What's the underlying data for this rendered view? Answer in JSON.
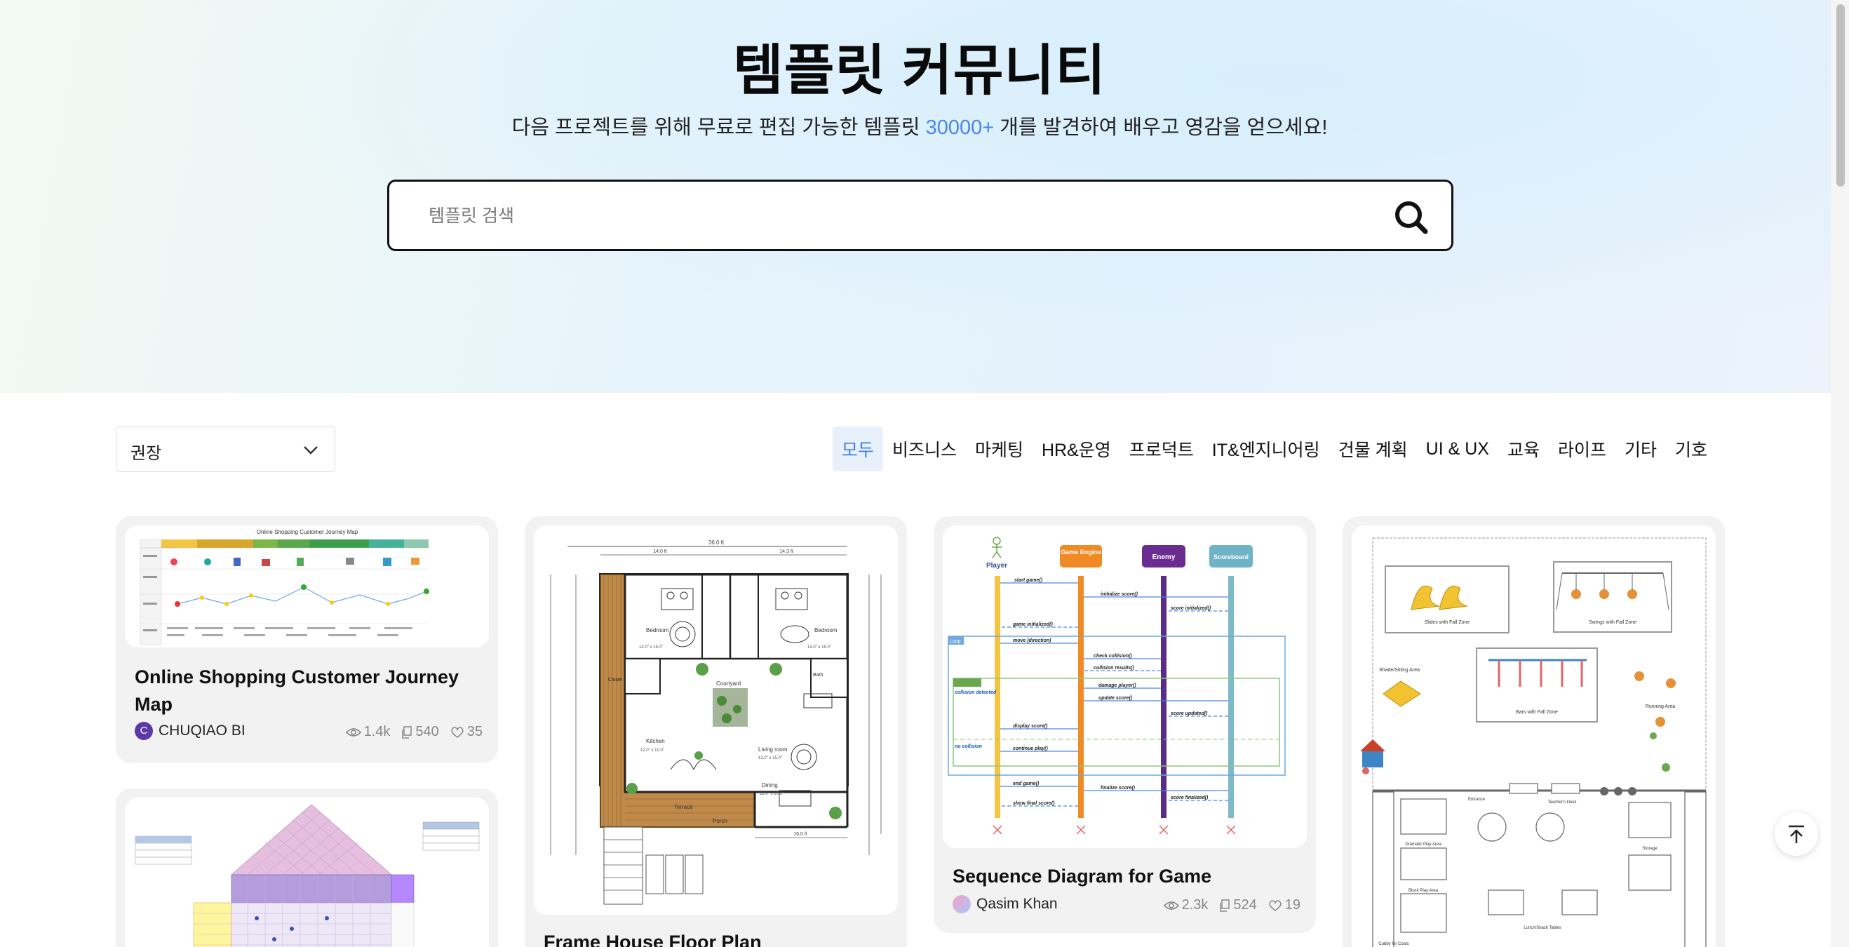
{
  "hero": {
    "title": "템플릿 커뮤니티",
    "subtitle_before": "다음 프로젝트를 위해 무료로 편집 가능한 템플릿 ",
    "subtitle_count": "30000+",
    "subtitle_after": " 개를 발견하여 배우고 영감을 얻으세요!"
  },
  "search": {
    "placeholder": "템플릿 검색",
    "icon": "search-icon"
  },
  "sort": {
    "selected": "권장",
    "icon": "chevron-down-icon"
  },
  "categories": [
    "모두",
    "비즈니스",
    "마케팅",
    "HR&운영",
    "프로덕트",
    "IT&엔지니어링",
    "건물 계획",
    "UI & UX",
    "교육",
    "라이프",
    "기타",
    "기호"
  ],
  "cards": [
    {
      "title": "Online Shopping Customer Journey Map",
      "author": "CHUQIAO BI",
      "avatar_letter": "C",
      "avatar_color": "#5b3aa8",
      "views": "1.4k",
      "copies": "540",
      "likes": "35"
    },
    {
      "title": "Frame House Floor Plan"
    },
    {
      "title": "Sequence Diagram for Game",
      "author": "Qasim Khan",
      "views": "2.3k",
      "copies": "524",
      "likes": "19"
    },
    {
      "title": ""
    }
  ],
  "thumb_text": {
    "journey_title": "Online Shopping Customer Journey Map",
    "floor": {
      "dim_top": "36.0 ft",
      "dim_a": "14.0 ft",
      "dim_b": "14.3 ft",
      "bed1": "Bedroom",
      "bed1_size": "14.0\" x 15.0\"",
      "bed2": "Bedroom",
      "bed2_size": "14.0\" x 15.0\"",
      "bath": "Bath",
      "closet": "Closet",
      "courtyard": "Courtyard",
      "kitchen": "Kitchen",
      "kitchen_size": "12.0\" x 10.0\"",
      "living": "Living room",
      "living_size": "12.0\" x 15.0\"",
      "dining": "Dining",
      "dining_size": "12.0\" x 10.0\"",
      "terrace": "Terrace",
      "porch": "Porch",
      "dim_bottom": "16.0 ft"
    },
    "seq": {
      "player": "Player",
      "engine": "Game Engine",
      "enemy": "Enemy",
      "scoreboard": "Scoreboard",
      "m1": "start game()",
      "m2": "initialize score()",
      "m3": "score initialized()",
      "m4": "game initialized()",
      "m5": "move (direction)",
      "m6": "check collision()",
      "m7": "collision results()",
      "m8": "damage player()",
      "m9": "update score()",
      "m10": "score updated()",
      "m11": "display score()",
      "m12": "continue play()",
      "m13": "end game()",
      "m14": "finalize score()",
      "m15": "score finalized()",
      "m16": "show final score()",
      "loop": "Loop",
      "alt1": "collision detected",
      "alt2": "no collision"
    },
    "play": {
      "a1": "Slides with Fall Zone",
      "a2": "Swings with Fall Zone",
      "a3": "Shade/Sitting Area",
      "a4": "Bars with Fall Zone",
      "a5": "Running Area",
      "a6": "Entrance",
      "a7": "Teacher's Desk",
      "a8": "Storage",
      "a9": "Dramatic Play Area",
      "a10": "Block Play Area",
      "a11": "Lunch/Snack Tables",
      "a12": "Cubby for Coats"
    }
  },
  "colors": {
    "accent": "#4a86e8",
    "active_bg": "#e8f1fb",
    "card_bg": "#f2f2f2"
  }
}
